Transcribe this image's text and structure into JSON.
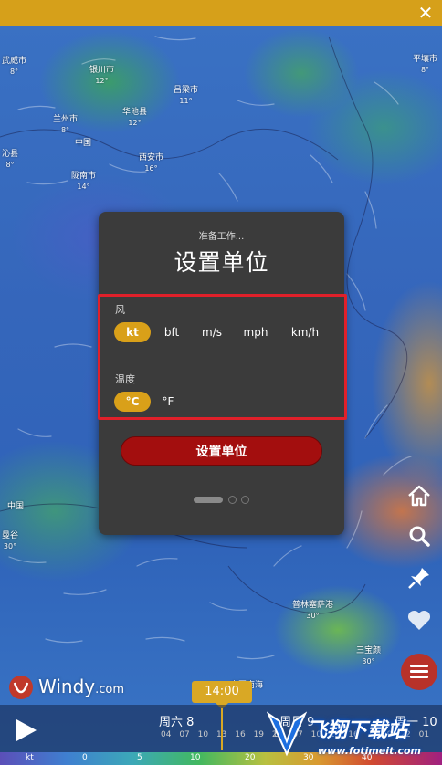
{
  "dialog": {
    "subtitle": "准备工作...",
    "title": "设置单位",
    "wind_label": "风",
    "wind_units": [
      "kt",
      "bft",
      "m/s",
      "mph",
      "km/h"
    ],
    "wind_selected": "kt",
    "temp_label": "温度",
    "temp_units": [
      "°C",
      "°F"
    ],
    "temp_selected": "°C",
    "button_label": "设置单位",
    "pager": {
      "pages": 3,
      "current": 1
    }
  },
  "map": {
    "cities": [
      {
        "name": "武威市",
        "temp": "8°"
      },
      {
        "name": "银川市",
        "temp": "12°"
      },
      {
        "name": "吕梁市",
        "temp": "11°"
      },
      {
        "name": "平壤市",
        "temp": "8°"
      },
      {
        "name": "兰州市",
        "temp": "8°"
      },
      {
        "name": "华池县",
        "temp": "12°"
      },
      {
        "name": "沁县",
        "temp": "8°"
      },
      {
        "name": "中国",
        "temp": ""
      },
      {
        "name": "西安市",
        "temp": "16°"
      },
      {
        "name": "陇南市",
        "temp": "14°"
      },
      {
        "name": "中国",
        "temp": ""
      },
      {
        "name": "曼谷",
        "temp": "30°"
      },
      {
        "name": "普林塞萨港",
        "temp": "30°"
      },
      {
        "name": "三宝颜",
        "temp": "30°"
      },
      {
        "name": "中国南海",
        "temp": ""
      }
    ]
  },
  "logo": {
    "brand": "Windy",
    "suffix": ".com"
  },
  "timeline": {
    "current_time": "14:00",
    "days": [
      {
        "label": "周六 8",
        "hours": "04 07 10 13 16 19 22"
      },
      {
        "label": "周日 9",
        "hours": "04 07 10 13 16"
      },
      {
        "label": "周一 10",
        "hours": "19 22 01"
      }
    ]
  },
  "scale": {
    "unit": "kt",
    "ticks": [
      "0",
      "5",
      "10",
      "20",
      "30",
      "40"
    ]
  },
  "watermark": {
    "text": "飞翔下载站",
    "url": "www.fotimeit.com"
  },
  "colors": {
    "topbar": "#d6a01a",
    "accent": "#d9a019",
    "primary_button": "#a30e0e",
    "dialog_bg": "#3b3b3b",
    "highlight_border": "#e0202a"
  }
}
